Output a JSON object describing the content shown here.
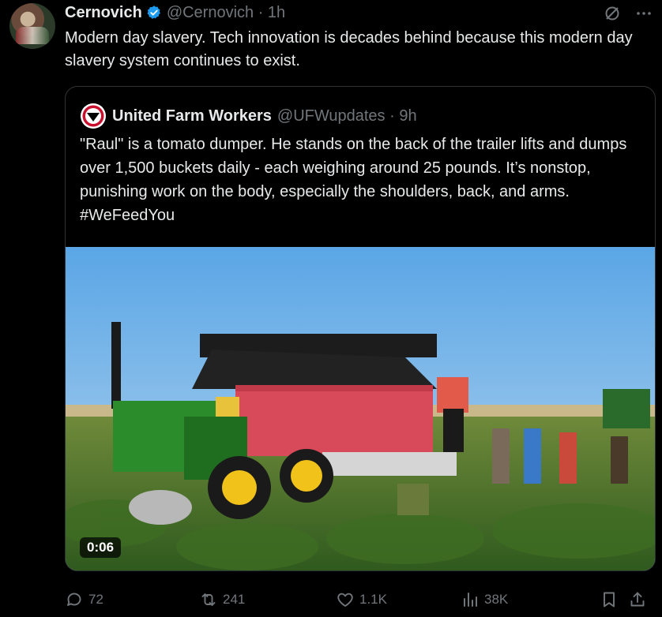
{
  "tweet": {
    "author_name": "Cernovich",
    "author_handle": "@Cernovich · 1h",
    "text": "Modern day slavery. Tech innovation is decades behind because this modern day slavery system continues to exist."
  },
  "quoted": {
    "author_name": "United Farm Workers",
    "author_handle": "@UFWupdates · 9h",
    "text": "\"Raul\" is a tomato dumper. He stands on the back of the trailer lifts and dumps over 1,500 buckets daily - each weighing around 25 pounds. It’s nonstop, punishing work on the body, especially the shoulders, back, and arms.",
    "hashtag": "#WeFeedYou",
    "video_duration": "0:06"
  },
  "actions": {
    "replies": "72",
    "reposts": "241",
    "likes": "1.1K",
    "views": "38K"
  },
  "icons": {
    "verified": "verified-badge-icon",
    "grok": "grok-icon",
    "more": "more-icon",
    "reply": "reply-icon",
    "repost": "repost-icon",
    "like": "heart-icon",
    "views": "views-icon",
    "bookmark": "bookmark-icon",
    "share": "share-icon"
  },
  "colors": {
    "background": "#000000",
    "text": "#e7e9ea",
    "muted": "#71767b",
    "verified": "#1d9bf0"
  }
}
